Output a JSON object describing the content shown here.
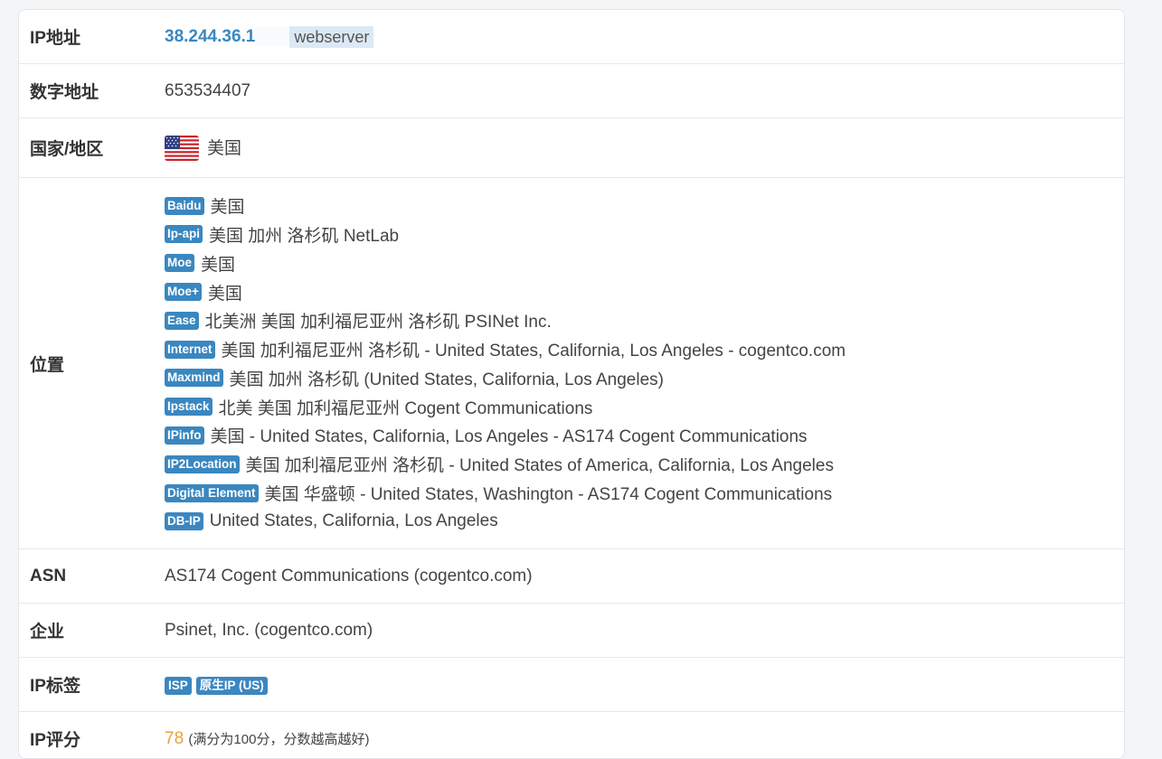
{
  "rows": {
    "ip": {
      "label": "IP地址",
      "address": "38.244.36.1",
      "host_tag": "webserver"
    },
    "numeric": {
      "label": "数字地址",
      "value": "653534407"
    },
    "country": {
      "label": "国家/地区",
      "flag_icon": "us-flag-icon",
      "value": "美国"
    },
    "location": {
      "label": "位置",
      "sources": [
        {
          "source": "Baidu",
          "text": "美国"
        },
        {
          "source": "Ip-api",
          "text": "美国 加州 洛杉矶 NetLab"
        },
        {
          "source": "Moe",
          "text": "美国"
        },
        {
          "source": "Moe+",
          "text": "美国"
        },
        {
          "source": "Ease",
          "text": "北美洲 美国 加利福尼亚州 洛杉矶 PSINet Inc."
        },
        {
          "source": "Internet",
          "text": "美国 加利福尼亚州 洛杉矶 - United States, California, Los Angeles - cogentco.com"
        },
        {
          "source": "Maxmind",
          "text": "美国 加州 洛杉矶 (United States, California, Los Angeles)"
        },
        {
          "source": "Ipstack",
          "text": "北美 美国 加利福尼亚州 Cogent Communications"
        },
        {
          "source": "IPinfo",
          "text": "美国 - United States, California, Los Angeles - AS174 Cogent Communications"
        },
        {
          "source": "IP2Location",
          "text": "美国 加利福尼亚州 洛杉矶 - United States of America, California, Los Angeles"
        },
        {
          "source": "Digital Element",
          "text": "美国 华盛顿 - United States, Washington - AS174 Cogent Communications"
        },
        {
          "source": "DB-IP",
          "text": "United States, California, Los Angeles"
        }
      ]
    },
    "asn": {
      "label": "ASN",
      "value": "AS174 Cogent Communications (cogentco.com)"
    },
    "org": {
      "label": "企业",
      "value": "Psinet, Inc. (cogentco.com)"
    },
    "tags": {
      "label": "IP标签",
      "items": [
        "ISP",
        "原生IP (US)"
      ]
    },
    "score": {
      "label": "IP评分",
      "value": "78",
      "note": "(满分为100分，分数越高越好)"
    }
  },
  "colors": {
    "accent": "#3a87c0",
    "score": "#e8a23a",
    "host_tag_bg": "#dbe9f5"
  }
}
